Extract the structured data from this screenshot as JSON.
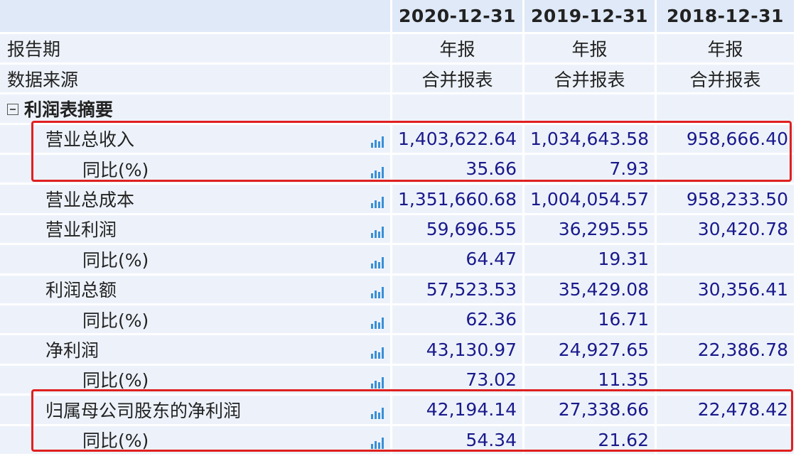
{
  "columns": [
    "2020-12-31",
    "2019-12-31",
    "2018-12-31"
  ],
  "rows": [
    {
      "label": "报告期",
      "level": 0,
      "type": "meta",
      "values": [
        "年报",
        "年报",
        "年报"
      ]
    },
    {
      "label": "数据来源",
      "level": 0,
      "type": "meta",
      "values": [
        "合并报表",
        "合并报表",
        "合并报表"
      ]
    },
    {
      "label": "利润表摘要",
      "level": 0,
      "type": "section",
      "values": [
        "",
        "",
        ""
      ]
    },
    {
      "label": "营业总收入",
      "level": 1,
      "type": "item",
      "values": [
        "1,403,622.64",
        "1,034,643.58",
        "958,666.40"
      ]
    },
    {
      "label": "同比(%)",
      "level": 2,
      "type": "item",
      "values": [
        "35.66",
        "7.93",
        ""
      ]
    },
    {
      "label": "营业总成本",
      "level": 1,
      "type": "item",
      "values": [
        "1,351,660.68",
        "1,004,054.57",
        "958,233.50"
      ]
    },
    {
      "label": "营业利润",
      "level": 1,
      "type": "item",
      "values": [
        "59,696.55",
        "36,295.55",
        "30,420.78"
      ]
    },
    {
      "label": "同比(%)",
      "level": 2,
      "type": "item",
      "values": [
        "64.47",
        "19.31",
        ""
      ]
    },
    {
      "label": "利润总额",
      "level": 1,
      "type": "item",
      "values": [
        "57,523.53",
        "35,429.08",
        "30,356.41"
      ]
    },
    {
      "label": "同比(%)",
      "level": 2,
      "type": "item",
      "values": [
        "62.36",
        "16.71",
        ""
      ]
    },
    {
      "label": "净利润",
      "level": 1,
      "type": "item",
      "values": [
        "43,130.97",
        "24,927.65",
        "22,386.78"
      ]
    },
    {
      "label": "同比(%)",
      "level": 2,
      "type": "item",
      "values": [
        "73.02",
        "11.35",
        ""
      ]
    },
    {
      "label": "归属母公司股东的净利润",
      "level": 1,
      "type": "item",
      "values": [
        "42,194.14",
        "27,338.66",
        "22,478.42"
      ]
    },
    {
      "label": "同比(%)",
      "level": 2,
      "type": "item",
      "values": [
        "54.34",
        "21.62",
        ""
      ]
    }
  ],
  "colors": {
    "header_bg": "#dfe9f7",
    "row_bg": "#edf2fa",
    "value_text": "#1a1a8c",
    "highlight": "#e02020",
    "icon": "#3a8fd6"
  },
  "icons": {
    "row_chart": "bar-chart-icon",
    "section_toggle": "collapse-toggle-icon"
  }
}
